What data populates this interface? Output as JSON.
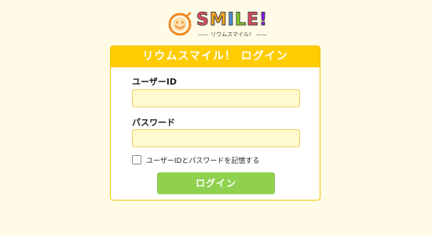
{
  "logo": {
    "wordmark_letters": [
      {
        "char": "S",
        "color": "#e84a5f"
      },
      {
        "char": "M",
        "color": "#f5a623"
      },
      {
        "char": "I",
        "color": "#4a90e2"
      },
      {
        "char": "L",
        "color": "#7ed321"
      },
      {
        "char": "E",
        "color": "#e84a5f"
      },
      {
        "char": "!",
        "color": "#9013fe"
      }
    ],
    "tagline": "リウムスマイル！",
    "sun_color": "#f08a24"
  },
  "login_card": {
    "title": "リウムスマイル！ ログイン",
    "user_id_label": "ユーザーID",
    "user_id_value": "",
    "password_label": "パスワード",
    "password_value": "",
    "remember_label": "ユーザーIDとパスワードを記憶する",
    "remember_checked": false,
    "submit_label": "ログイン"
  },
  "colors": {
    "page_bg": "#fffbe6",
    "header_bg": "#ffcc00",
    "input_bg": "#fff9d0",
    "button_bg": "#8fd14f"
  }
}
